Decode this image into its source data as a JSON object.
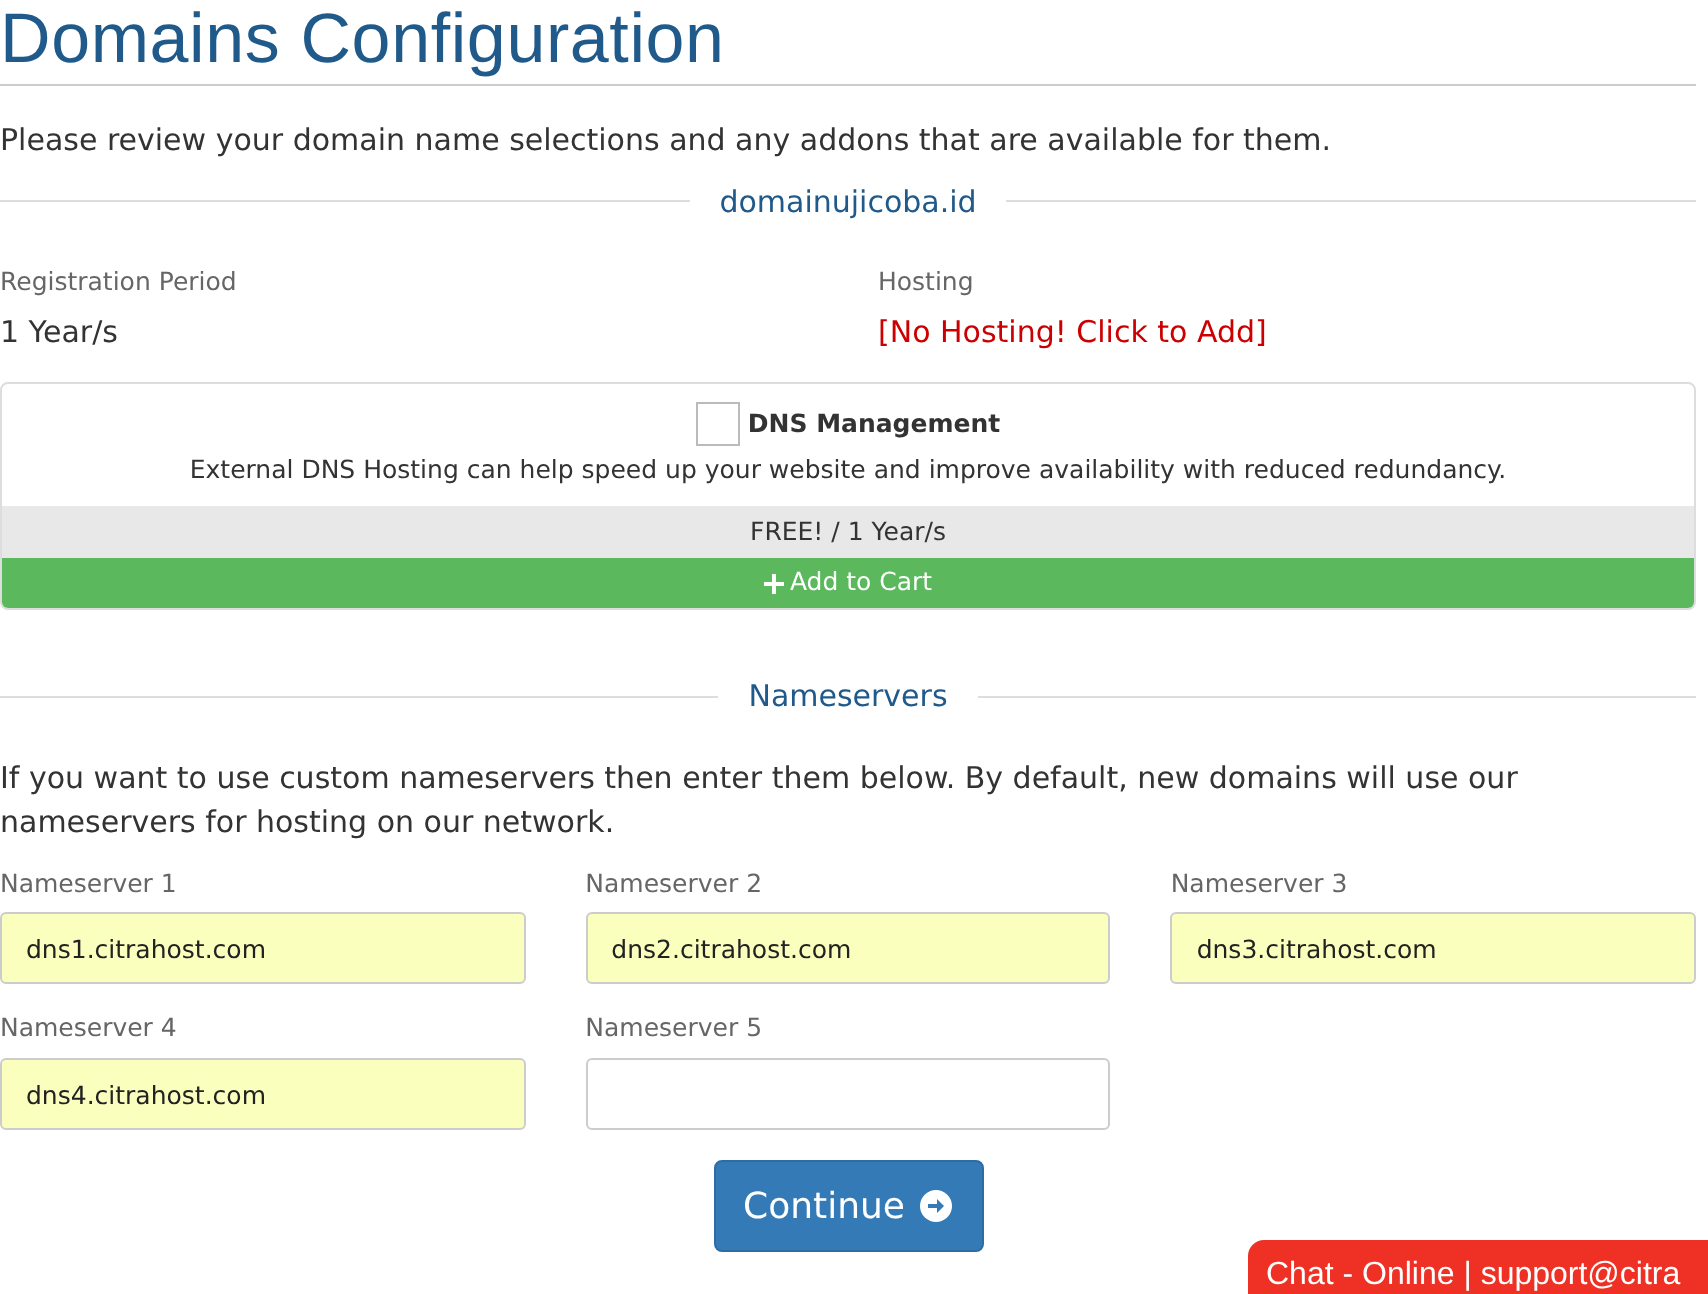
{
  "title": "Domains Configuration",
  "intro": "Please review your domain name selections and any addons that are available for them.",
  "domain": {
    "name": "domainujicoba.id",
    "registration": {
      "label": "Registration Period",
      "value": "1 Year/s"
    },
    "hosting": {
      "label": "Hosting",
      "value": "[No Hosting! Click to Add]"
    }
  },
  "addon": {
    "name": "DNS Management",
    "checked": false,
    "description": "External DNS Hosting can help speed up your website and improve availability with reduced redundancy.",
    "price": "FREE! / 1 Year/s",
    "button": "Add to Cart"
  },
  "nameservers": {
    "heading": "Nameservers",
    "text": "If you want to use custom nameservers then enter them below. By default, new domains will use our nameservers for hosting on our network.",
    "fields": [
      {
        "label": "Nameserver 1",
        "value": "dns1.citrahost.com",
        "autofilled": true
      },
      {
        "label": "Nameserver 2",
        "value": "dns2.citrahost.com",
        "autofilled": true
      },
      {
        "label": "Nameserver 3",
        "value": "dns3.citrahost.com",
        "autofilled": true
      },
      {
        "label": "Nameserver 4",
        "value": "dns4.citrahost.com",
        "autofilled": true
      },
      {
        "label": "Nameserver 5",
        "autofilled": false
      }
    ]
  },
  "continue_button": "Continue",
  "chat": "Chat - Online | support@citra"
}
